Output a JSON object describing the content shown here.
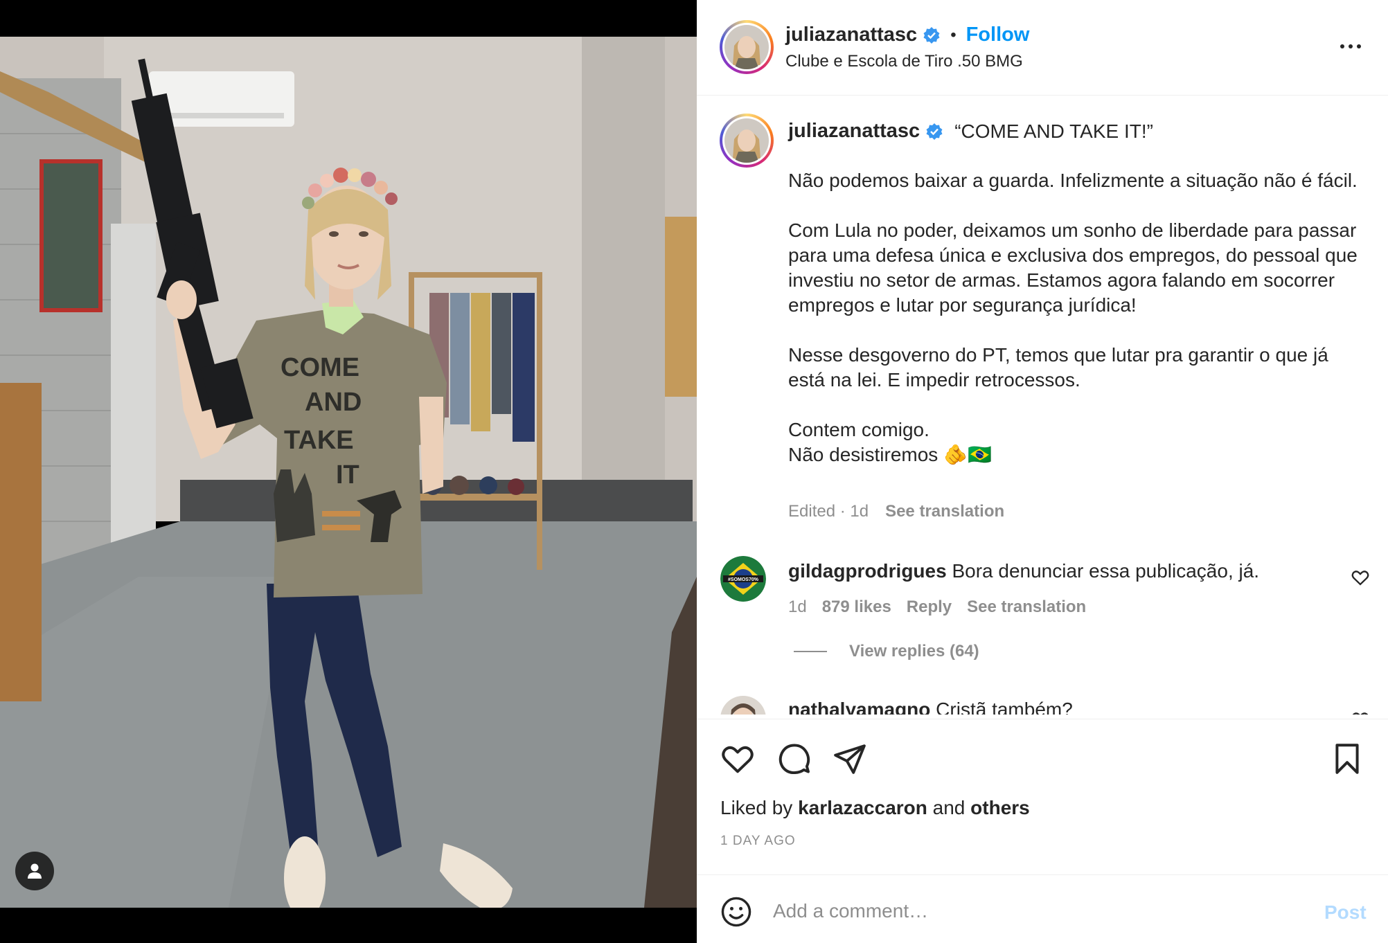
{
  "colors": {
    "accent": "#0095f6",
    "verified": "#3897f0",
    "muted": "#8e8e8e",
    "post_disabled": "#b3dbff"
  },
  "header": {
    "username": "juliazanattasc",
    "separator": "•",
    "follow_label": "Follow",
    "location": "Clube e Escola de Tiro .50 BMG"
  },
  "caption": {
    "username": "juliazanattasc",
    "headline": "“COME AND TAKE IT!”",
    "paragraphs": [
      "Não podemos baixar a guarda. Infelizmente a situação não é fácil.",
      "Com Lula no poder, deixamos um sonho de liberdade para passar para uma defesa única e exclusiva dos empregos, do pessoal que investiu no setor de armas. Estamos agora falando em socorrer empregos e lutar por segurança jurídica!",
      "Nesse desgoverno do PT, temos que lutar pra garantir o que já está na lei. E impedir retrocessos.",
      "Contem comigo.",
      "Não desistiremos 🫵🇧🇷"
    ],
    "edited": "Edited · 1d",
    "see_translation": "See translation"
  },
  "comments": [
    {
      "username": "gildagprodrigues",
      "text": "Bora denunciar essa publicação, já.",
      "time": "1d",
      "likes": "879 likes",
      "reply": "Reply",
      "see_translation": "See translation",
      "avatar_text": "#SOMOS70%"
    },
    {
      "username": "nathalyamagno",
      "text": "Cristã também?"
    }
  ],
  "view_replies": "View replies (64)",
  "actions": {
    "liked_by_prefix": "Liked by",
    "liked_by_user": "karlazaccaron",
    "liked_by_and": "and",
    "liked_by_others": "others",
    "post_age": "1 DAY AGO",
    "icons": [
      "heart-icon",
      "comment-icon",
      "share-icon",
      "bookmark-icon"
    ]
  },
  "comment_box": {
    "placeholder": "Add a comment…",
    "post_label": "Post"
  }
}
